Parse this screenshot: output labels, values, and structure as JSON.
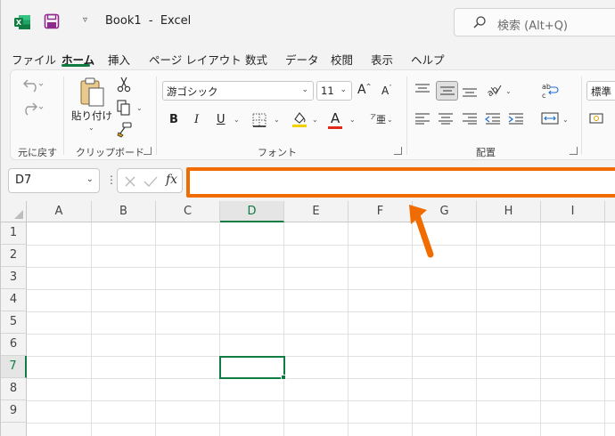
{
  "titlebar": {
    "app": "excel-icon",
    "qat_dropdown": "▿",
    "title": "Book1  -  Excel",
    "search_placeholder": "検索 (Alt+Q)"
  },
  "tabs": [
    "ファイル",
    "ホーム",
    "挿入",
    "ページ レイアウト",
    "数式",
    "データ",
    "校閲",
    "表示",
    "ヘルプ"
  ],
  "active_tab": "ホーム",
  "ribbon": {
    "undo_group": {
      "label": "元に戻す"
    },
    "clipboard": {
      "paste": "貼り付け",
      "label": "クリップボード"
    },
    "font": {
      "name": "游ゴシック",
      "size": "11",
      "grow": "A",
      "shrink": "A",
      "bold": "B",
      "italic": "I",
      "underline": "U",
      "font_color_glyph": "A",
      "phonetic": "亜",
      "label": "フォント",
      "highlight_color": "#f5d000",
      "font_color": "#e0281b"
    },
    "alignment": {
      "label": "配置"
    },
    "number": {
      "format": "標準"
    }
  },
  "formula_bar": {
    "name_box": "D7",
    "dots": "⋮",
    "fx": "fx",
    "value": "",
    "highlight_color": "#f06c00"
  },
  "grid": {
    "columns": [
      "A",
      "B",
      "C",
      "D",
      "E",
      "F",
      "G",
      "H",
      "I"
    ],
    "rows": [
      "1",
      "2",
      "3",
      "4",
      "5",
      "6",
      "7",
      "8",
      "9"
    ],
    "selected_column": "D",
    "selected_row": "7",
    "accent": "#107c41"
  }
}
